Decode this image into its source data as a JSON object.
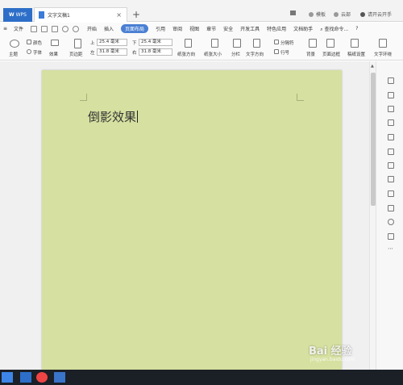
{
  "titlebar": {
    "app_tab": "WPS",
    "doc_tab": "文字文稿1",
    "close_glyph": "×",
    "new_tab_glyph": "+",
    "skin_label": "模板",
    "tools_label": "云部",
    "user_label": "请开云开手"
  },
  "menubar": {
    "items": [
      "文件",
      "开始",
      "插入",
      "页面布局",
      "引用",
      "审阅",
      "视图",
      "章节",
      "安全",
      "开发工具",
      "特色应用",
      "文档助手"
    ],
    "active_index": 3,
    "search": "查找命令...",
    "help": "?"
  },
  "ribbon": {
    "theme": "主题",
    "colors": "颜色",
    "fonts": "字体",
    "effects": "效果",
    "margins": "页边距",
    "top_label": "上",
    "top_value": "25.4 毫米",
    "bottom_label": "下",
    "bottom_value": "25.4 毫米",
    "left_label": "左",
    "left_value": "31.8 毫米",
    "right_label": "右",
    "right_value": "31.8 毫米",
    "orientation": "纸张方向",
    "size": "纸张大小",
    "columns": "分栏",
    "text_direction": "文字方向",
    "breaks": "分隔符",
    "line_numbers": "行号",
    "background": "背景",
    "page_border": "页面边框",
    "paper_setup": "稿纸设置",
    "text_wrap": "文字环绕"
  },
  "document": {
    "text": "倒影效果"
  },
  "watermark": {
    "brand": "Bai 经验",
    "url": "jingyan.baidu.com"
  },
  "colors": {
    "page_bg": "#d6e0a0",
    "accent": "#4a7fd3",
    "taskbar": "#1b1f26"
  }
}
